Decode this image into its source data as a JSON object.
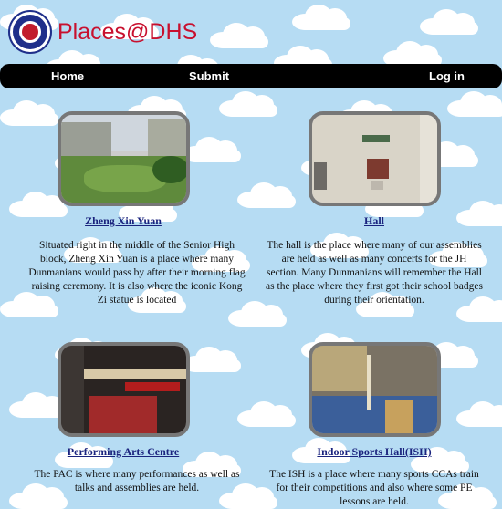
{
  "header": {
    "brand": "Places@DHS"
  },
  "nav": {
    "home": "Home",
    "submit": "Submit",
    "login": "Log in"
  },
  "places": [
    {
      "title": "Zheng Xin Yuan",
      "desc": "Situated right in the middle of the Senior High block, Zheng Xin Yuan is a place where many Dunmanians would pass by after their morning flag raising ceremony. It is also where the iconic Kong Zi statue is located"
    },
    {
      "title": "Hall",
      "desc": "The hall is the place where many of our assemblies are held as well as many concerts for the JH section. Many Dunmanians will remember the Hall as the place where they first got their school badges during their orientation."
    },
    {
      "title": "Performing Arts Centre",
      "desc": "The PAC is where many performances as well as talks and assemblies are held."
    },
    {
      "title": "Indoor Sports Hall(ISH)",
      "desc": "The ISH is a place where many sports CCAs train for their competitions and also where some PE lessons are held."
    }
  ],
  "colors": {
    "brand": "#c8102e",
    "link": "#1a237e",
    "navbar": "#000000",
    "sky": "#b6dcf3"
  }
}
